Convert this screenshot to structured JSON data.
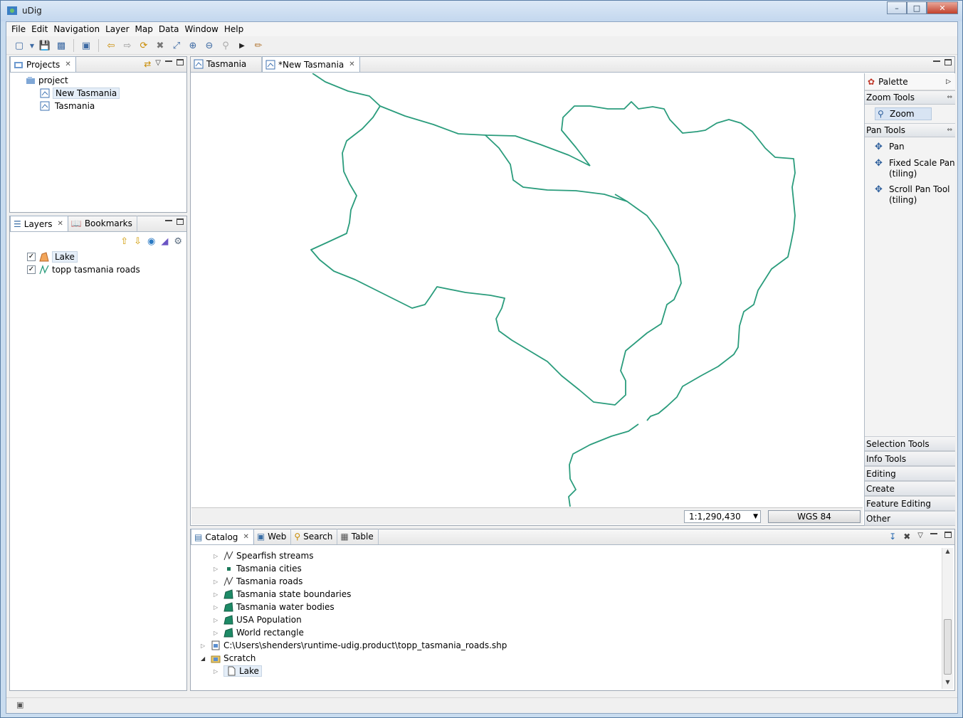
{
  "window": {
    "title": "uDig"
  },
  "menu": [
    "File",
    "Edit",
    "Navigation",
    "Layer",
    "Map",
    "Data",
    "Window",
    "Help"
  ],
  "projects_panel": {
    "tab": "Projects",
    "root": "project",
    "maps": [
      "New Tasmania",
      "Tasmania"
    ]
  },
  "layers_panel": {
    "tabs": [
      "Layers",
      "Bookmarks"
    ],
    "layers": [
      {
        "name": "Lake",
        "checked": true
      },
      {
        "name": "topp tasmania roads",
        "checked": true
      }
    ]
  },
  "editor_tabs": [
    "Tasmania",
    "*New Tasmania"
  ],
  "map_status": {
    "scale": "1:1,290,430",
    "crs": "WGS 84"
  },
  "map_style": {
    "line_color": "#2a9c7c"
  },
  "palette": {
    "title": "Palette",
    "zoom_tools": {
      "label": "Zoom Tools",
      "items": [
        "Zoom"
      ]
    },
    "pan_tools": {
      "label": "Pan Tools",
      "items": [
        "Pan",
        "Fixed Scale Pan",
        "(tiling)",
        "Scroll Pan Tool",
        "(tiling)"
      ]
    },
    "drawers": [
      "Selection Tools",
      "Info Tools",
      "Editing",
      "Create",
      "Feature Editing",
      "Other"
    ]
  },
  "bottom_tabs": [
    "Catalog",
    "Web",
    "Search",
    "Table"
  ],
  "catalog": {
    "items": [
      "Spearfish streams",
      "Tasmania cities",
      "Tasmania roads",
      "Tasmania state boundaries",
      "Tasmania water bodies",
      "USA Population",
      "World rectangle"
    ],
    "file": "C:\\Users\\shenders\\runtime-udig.product\\topp_tasmania_roads.shp",
    "scratch": "Scratch",
    "scratch_child": "Lake"
  }
}
